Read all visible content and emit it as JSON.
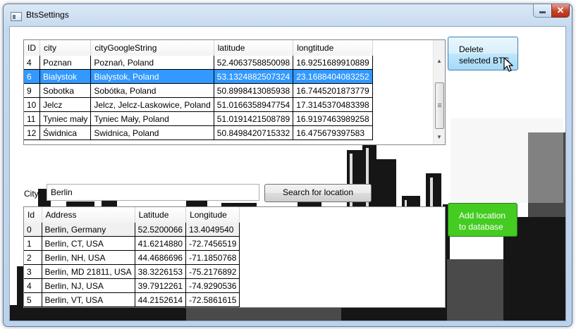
{
  "window": {
    "title": "BtsSettings"
  },
  "title_buttons": {
    "close": "✕"
  },
  "bts_table": {
    "columns": [
      "ID",
      "city",
      "cityGoogleString",
      "latitude",
      "longtitude"
    ],
    "rows": [
      [
        "4",
        "Poznan",
        "Poznań, Poland",
        "52.4063758850098",
        "16.9251689910889"
      ],
      [
        "6",
        "Bialystok",
        "Bialystok, Poland",
        "53.1324882507324",
        "23.1688404083252"
      ],
      [
        "9",
        "Sobotka",
        "Sobótka, Poland",
        "50.8998413085938",
        "16.7445201873779"
      ],
      [
        "10",
        "Jelcz",
        "Jelcz, Jelcz-Laskowice, Poland",
        "51.0166358947754",
        "17.3145370483398"
      ],
      [
        "11",
        "Tyniec mały",
        "Tyniec Mały, Poland",
        "51.0191421508789",
        "16.9197463989258"
      ],
      [
        "12",
        "Świdnica",
        "Swidnica, Poland",
        "50.8498420715332",
        "16.475679397583"
      ]
    ],
    "selected_row": 1
  },
  "delete_button": {
    "line1": "Delete",
    "line2": "selected BTS"
  },
  "search": {
    "city_label": "City:",
    "city_value": "Berlin",
    "button": "Search for location"
  },
  "location_table": {
    "columns": [
      "Id",
      "Address",
      "Latitude",
      "Longitude"
    ],
    "rows": [
      [
        "0",
        "Berlin, Germany",
        "52.5200066",
        "13.4049540"
      ],
      [
        "1",
        "Berlin, CT, USA",
        "41.6214880",
        "-72.7456519"
      ],
      [
        "2",
        "Berlin, NH, USA",
        "44.4686696",
        "-71.1850768"
      ],
      [
        "3",
        "Berlin, MD 21811, USA",
        "38.3226153",
        "-75.2176892"
      ],
      [
        "4",
        "Berlin, NJ, USA",
        "39.7912261",
        "-74.9290536"
      ],
      [
        "5",
        "Berlin, VT, USA",
        "44.2152614",
        "-72.5861615"
      ]
    ],
    "current_row": 0
  },
  "add_button": {
    "line1": "Add location",
    "line2": "to database"
  },
  "colors": {
    "selection": "#3399ff",
    "add_button": "#44cc22",
    "delete_button": "#bee6fd"
  }
}
